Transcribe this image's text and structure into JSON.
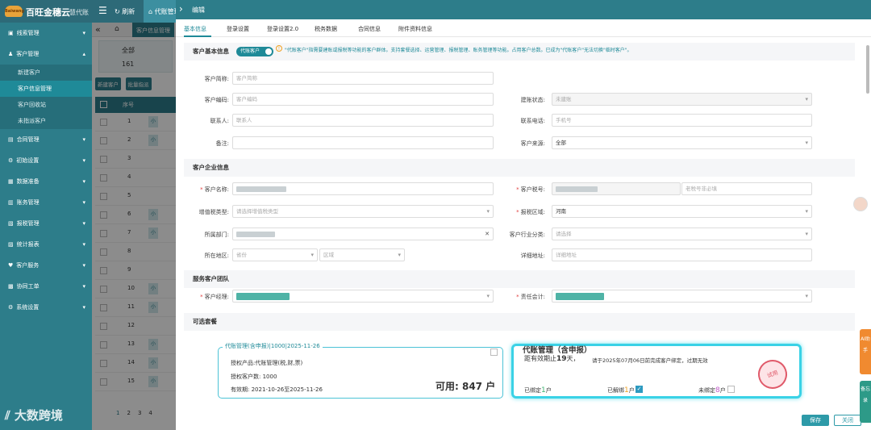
{
  "app": {
    "brand": "百旺金穗云",
    "brand_sub": "慧代账",
    "refresh": "刷新",
    "tab": "代账管理",
    "logo": "Baiwang"
  },
  "sidebar": {
    "items": [
      {
        "label": "线索管理",
        "icon": "clue-icon"
      },
      {
        "label": "客户管理",
        "icon": "user-icon",
        "expanded": true,
        "subs": [
          "新建客户",
          "客户信息管理",
          "客户回收站",
          "未指派客户"
        ]
      },
      {
        "label": "合同管理",
        "icon": "contract-icon"
      },
      {
        "label": "初始设置",
        "icon": "gear-icon"
      },
      {
        "label": "数据准备",
        "icon": "data-icon"
      },
      {
        "label": "账务管理",
        "icon": "ledger-icon"
      },
      {
        "label": "报税管理",
        "icon": "tax-icon"
      },
      {
        "label": "统计报表",
        "icon": "chart-icon"
      },
      {
        "label": "客户服务",
        "icon": "service-icon"
      },
      {
        "label": "协同工单",
        "icon": "ticket-icon"
      },
      {
        "label": "系统设置",
        "icon": "settings-icon"
      }
    ]
  },
  "page": {
    "tab": "客户信息管理",
    "stat_label": "全部",
    "stat_count": "161",
    "btn_new": "新建客户",
    "btn_batch": "批量指派",
    "col_no": "序号",
    "rows": [
      {
        "no": "1",
        "tag": "小"
      },
      {
        "no": "2",
        "tag": "小"
      },
      {
        "no": "3",
        "tag": ""
      },
      {
        "no": "4",
        "tag": ""
      },
      {
        "no": "5",
        "tag": ""
      },
      {
        "no": "6",
        "tag": "小"
      },
      {
        "no": "7",
        "tag": "小"
      },
      {
        "no": "8",
        "tag": ""
      },
      {
        "no": "9",
        "tag": ""
      },
      {
        "no": "10",
        "tag": "小"
      },
      {
        "no": "11",
        "tag": "小"
      },
      {
        "no": "12",
        "tag": ""
      },
      {
        "no": "13",
        "tag": "小"
      },
      {
        "no": "14",
        "tag": "小"
      },
      {
        "no": "15",
        "tag": "小"
      }
    ],
    "pages": [
      "1",
      "2",
      "3",
      "4"
    ]
  },
  "drawer": {
    "title": "编辑",
    "tabs": [
      "基本信息",
      "登录设置",
      "登录设置2.0",
      "税务数据",
      "合同信息",
      "附件资料信息"
    ],
    "sec_basic": "客户基本信息",
    "switch_label": "代账客户",
    "note": "\"代账客户\"指需要建账或报税等功能的客户群体。支持套餐选择、运营管理、报税管理、账务管理等功能。占用客户总数。已成为\"代账客户\"无法切换\"临时客户\"。",
    "f": {
      "short_name_l": "客户简称:",
      "short_name_p": "客户简称",
      "code_l": "客户编码:",
      "code_p": "客户编码",
      "status_l": "建账状态:",
      "status_p": "未建账",
      "contact_l": "联系人:",
      "contact_p": "联系人",
      "phone_l": "联系电话:",
      "phone_p": "手机号",
      "remark_l": "备注:",
      "source_l": "客户来源:",
      "source_v": "全部"
    },
    "sec_company": "客户企业信息",
    "c": {
      "name_l": "客户名称:",
      "taxno_l": "客户税号:",
      "oldtax_p": "老税号非必填",
      "vat_l": "增值税类型:",
      "vat_p": "请选择增值税类型",
      "area_l": "报税区域:",
      "area_v": "河南",
      "dept_l": "所属部门:",
      "ind_l": "客户行业分类:",
      "ind_p": "请选择",
      "region_l": "所在地区:",
      "prov_p": "省份",
      "dist_p": "区域",
      "addr_l": "详细地址:",
      "addr_p": "详细地址"
    },
    "sec_team": "服务客户团队",
    "t": {
      "mgr_l": "客户经理:",
      "acct_l": "责任会计:"
    },
    "sec_pkg": "可选套餐",
    "pkg1": {
      "title": "代账管理(含申报)|1000|2025-11-26",
      "product": "授权产品:代账管理(税,财,票)",
      "count": "授权客户数: 1000",
      "valid": "有效期: 2021-10-26至2025-11-26",
      "avail": "可用: 847 户"
    },
    "pkg2": {
      "title": "代账管理（含申报）",
      "days_pre": "距有效期止",
      "days": "19",
      "days_post": "天，",
      "hint": "请于2025年07月06日前完成客户绑定，过期无效",
      "stamp": "试用",
      "bound_l": "已绑定",
      "bound_n": "1",
      "unbound_l": "已解绑",
      "unbound_n": "1",
      "notbound_l": "未绑定",
      "notbound_n": "8",
      "unit": "户"
    },
    "save": "保存",
    "close": "关闭"
  },
  "right": {
    "ai": "AI助手",
    "memo": "备忘录"
  },
  "watermark": "大数跨境"
}
